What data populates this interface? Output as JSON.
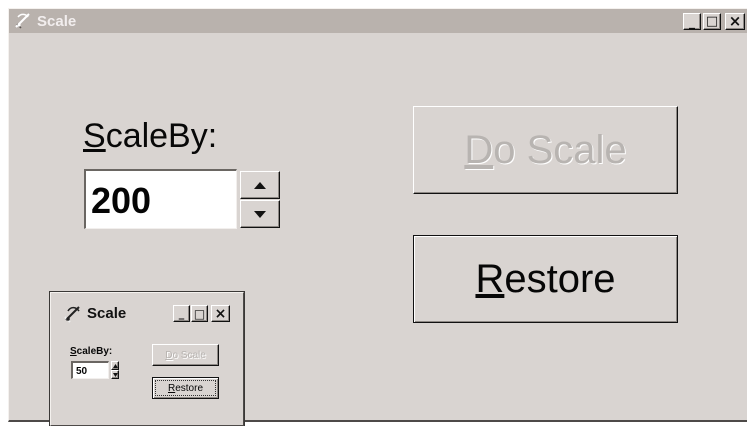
{
  "window": {
    "title": "Scale",
    "icon": "scale-app-icon",
    "buttons": {
      "minimize": "_",
      "maximize": "□",
      "close": "×"
    }
  },
  "main": {
    "scale_label": "ScaleBy:",
    "scale_value": "200",
    "do_scale_label": "Do Scale",
    "restore_label": "Restore",
    "spinner": {
      "up_icon": "up-arrow-icon",
      "down_icon": "down-arrow-icon"
    }
  },
  "preview": {
    "title": "Scale",
    "scale_label": "ScaleBy:",
    "scale_value": "50",
    "do_scale_label": "Do Scale",
    "restore_label": "Restore"
  },
  "colors": {
    "window_background": "#d9d4d1",
    "titlebar": "#b9b2ad",
    "title_text": "#f2eeee",
    "disabled_text": "#b8b4b1"
  }
}
